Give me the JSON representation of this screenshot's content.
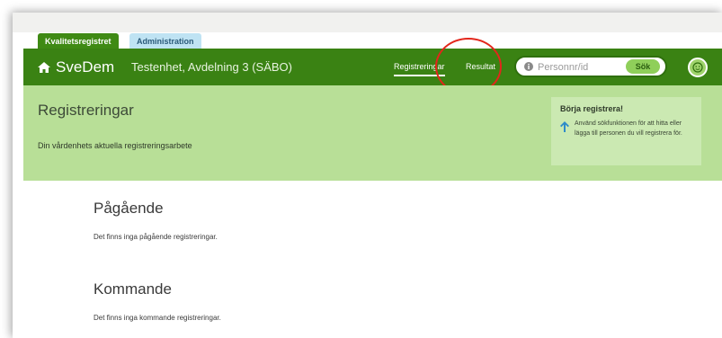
{
  "tabs": [
    {
      "label": "Kvalitetsregistret"
    },
    {
      "label": "Administration"
    }
  ],
  "navbar": {
    "brand": "SveDem",
    "unit": "Testenhet, Avdelning 3 (SÄBO)",
    "links": [
      {
        "label": "Registreringar",
        "active": true
      },
      {
        "label": "Resultat",
        "active": false
      }
    ],
    "search": {
      "placeholder": "Personnr/id",
      "button_label": "Sök"
    },
    "icons": {
      "brand": "home-icon",
      "search_info": "info-icon",
      "avatar": "avatar-icon"
    }
  },
  "banner": {
    "title": "Registreringar",
    "subtitle": "Din vårdenhets aktuella registreringsarbete",
    "help": {
      "title": "Börja registrera!",
      "text": "Använd sökfunktionen för att hitta eller lägga till personen du vill registrera för.",
      "icon": "arrow-up-icon"
    }
  },
  "sections": [
    {
      "heading": "Pågående",
      "text": "Det finns inga pågående registreringar."
    },
    {
      "heading": "Kommande",
      "text": "Det finns inga kommande registreringar."
    }
  ],
  "colors": {
    "nav_green": "#3a8213",
    "banner_green": "#b8df97",
    "highlight_red": "#e3261b"
  }
}
